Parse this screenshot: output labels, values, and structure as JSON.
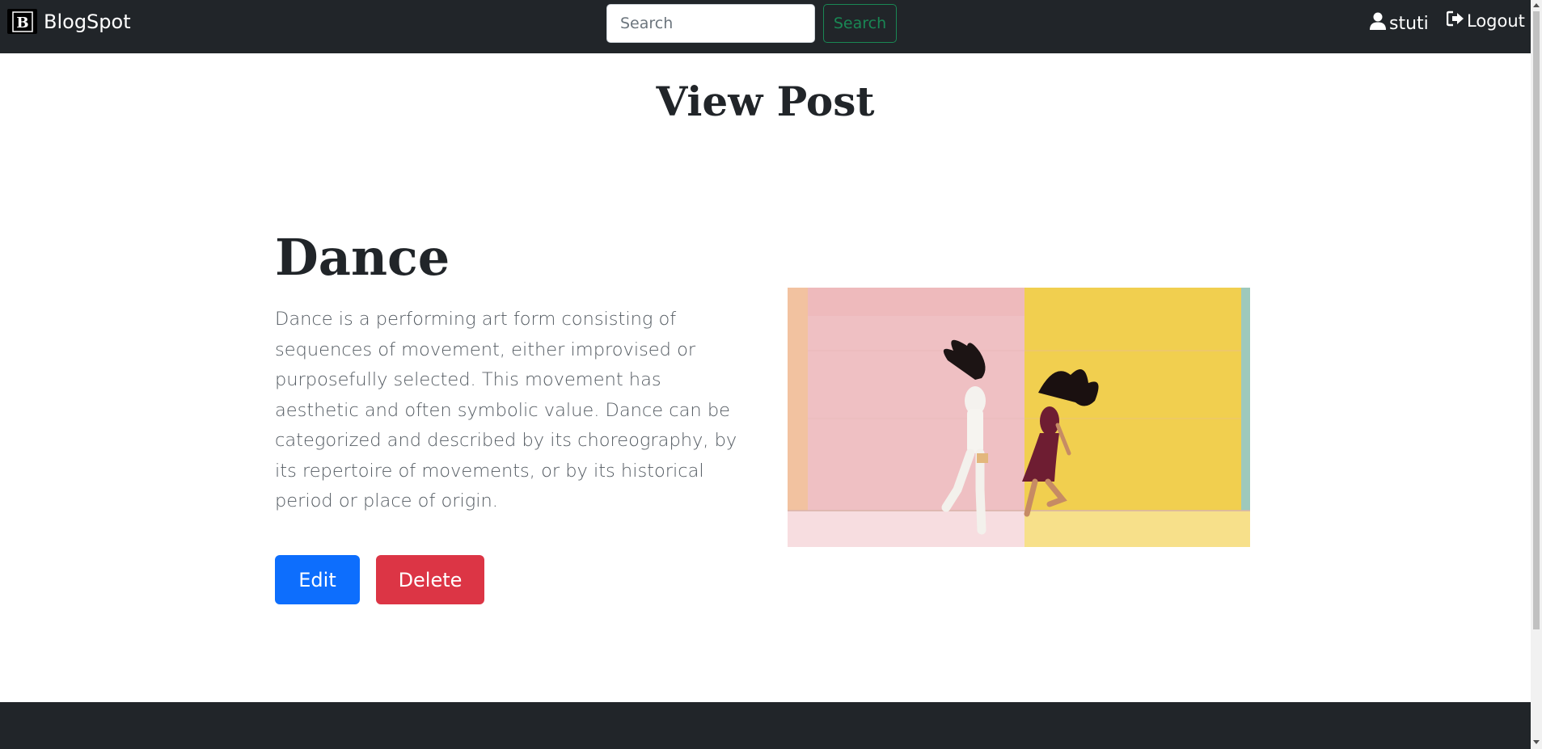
{
  "navbar": {
    "brand_name": "BlogSpot",
    "search_placeholder": "Search",
    "search_button_label": "Search",
    "username": "stuti",
    "logout_label": "Logout"
  },
  "page": {
    "title": "View Post"
  },
  "post": {
    "title": "Dance",
    "body": "Dance is a performing art form consisting of sequences of movement, either improvised or purposefully selected. This movement has aesthetic and often symbolic value. Dance can be categorized and described by its choreography, by its repertoire of movements, or by its historical period or place of origin.",
    "edit_label": "Edit",
    "delete_label": "Delete"
  },
  "icons": {
    "brand": "brand-logo-icon",
    "user": "user-icon",
    "logout": "logout-icon"
  },
  "colors": {
    "navbar_bg": "#212529",
    "edit_button": "#0d6efd",
    "delete_button": "#dc3545",
    "search_button": "#198754"
  }
}
